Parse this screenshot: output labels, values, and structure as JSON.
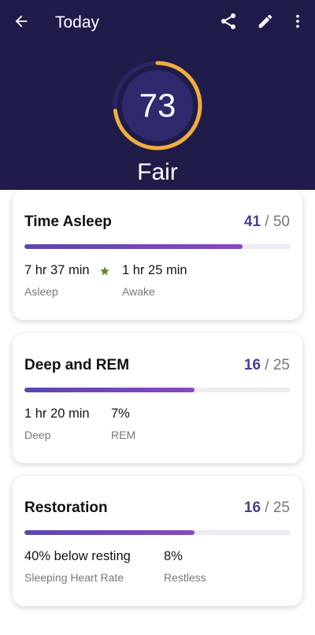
{
  "header": {
    "title": "Today",
    "icons": {
      "back": "arrow-left-icon",
      "share": "share-icon",
      "edit": "pencil-icon",
      "more": "more-vertical-icon"
    }
  },
  "score": {
    "value": "73",
    "label": "Fair",
    "ring_fraction": 0.73,
    "ring_color": "#f2ae3c"
  },
  "colors": {
    "header_bg": "#201c4a",
    "accent": "#4b3d8f",
    "star": "#5f8a2b"
  },
  "cards": [
    {
      "title": "Time Asleep",
      "score": "41",
      "max": "50",
      "fill_fraction": 0.82,
      "stats": [
        {
          "value": "7 hr 37 min",
          "label": "Asleep",
          "star": true
        },
        {
          "value": "1 hr 25 min",
          "label": "Awake"
        }
      ]
    },
    {
      "title": "Deep and REM",
      "score": "16",
      "max": "25",
      "fill_fraction": 0.64,
      "stats": [
        {
          "value": "1 hr 20 min",
          "label": "Deep"
        },
        {
          "value": "7%",
          "label": "REM"
        }
      ]
    },
    {
      "title": "Restoration",
      "score": "16",
      "max": "25",
      "fill_fraction": 0.64,
      "stats": [
        {
          "value": "40% below resting",
          "label": "Sleeping Heart Rate"
        },
        {
          "value": "8%",
          "label": "Restless"
        }
      ]
    }
  ]
}
